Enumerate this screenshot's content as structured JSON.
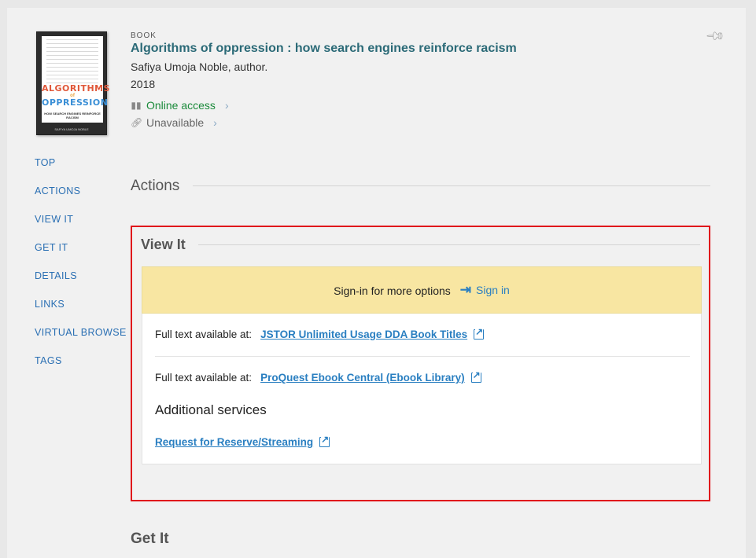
{
  "record": {
    "type": "BOOK",
    "title": "Algorithms of oppression : how search engines reinforce racism",
    "author": "Safiya Umoja Noble, author.",
    "year": "2018",
    "online_access": "Online access",
    "unavailable": "Unavailable",
    "cover": {
      "title_line1": "ALGORITHMS",
      "title_of": "of",
      "title_line2": "OPPRESSION",
      "subtitle": "HOW SEARCH ENGINES REINFORCE RACISM",
      "author": "SAFIYA UMOJA NOBLE"
    }
  },
  "sidenav": {
    "items": [
      "TOP",
      "ACTIONS",
      "VIEW IT",
      "GET IT",
      "DETAILS",
      "LINKS",
      "VIRTUAL BROWSE",
      "TAGS"
    ]
  },
  "actions": {
    "title": "Actions"
  },
  "view_it": {
    "title": "View It",
    "signin_prompt": "Sign-in for more options",
    "signin_label": "Sign in",
    "full_text_label": "Full text available at:",
    "links": [
      "JSTOR Unlimited Usage DDA Book Titles",
      "ProQuest Ebook Central (Ebook Library)"
    ],
    "additional_services_title": "Additional services",
    "request_link": "Request for Reserve/Streaming"
  },
  "get_it": {
    "title": "Get It"
  },
  "colors": {
    "accent": "#2a7fc1",
    "title": "#2b6a77",
    "online": "#1a8a3a",
    "highlight_border": "#e0141b",
    "signin_bg": "#f8e6a2"
  }
}
